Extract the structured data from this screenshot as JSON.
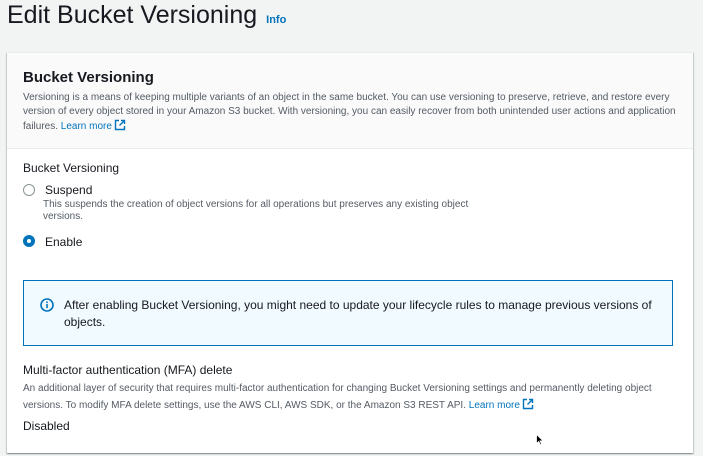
{
  "header": {
    "title": "Edit Bucket Versioning",
    "info": "Info"
  },
  "panel": {
    "title": "Bucket Versioning",
    "description": "Versioning is a means of keeping multiple variants of an object in the same bucket. You can use versioning to preserve, retrieve, and restore every version of every object stored in your Amazon S3 bucket. With versioning, you can easily recover from both unintended user actions and application failures.",
    "learn_more": "Learn more"
  },
  "versioning": {
    "label": "Bucket Versioning",
    "options": [
      {
        "label": "Suspend",
        "description": "This suspends the creation of object versions for all operations but preserves any existing object versions.",
        "checked": false
      },
      {
        "label": "Enable",
        "description": "",
        "checked": true
      }
    ]
  },
  "alert": {
    "icon": "info-circle-icon",
    "text": "After enabling Bucket Versioning, you might need to update your lifecycle rules to manage previous versions of objects."
  },
  "mfa": {
    "title": "Multi-factor authentication (MFA) delete",
    "description": "An additional layer of security that requires multi-factor authentication for changing Bucket Versioning settings and permanently deleting object versions. To modify MFA delete settings, use the AWS CLI, AWS SDK, or the Amazon S3 REST API.",
    "learn_more": "Learn more",
    "value": "Disabled"
  },
  "colors": {
    "link": "#0073bb",
    "alert_bg": "#f1faff",
    "background": "#f2f3f3"
  }
}
